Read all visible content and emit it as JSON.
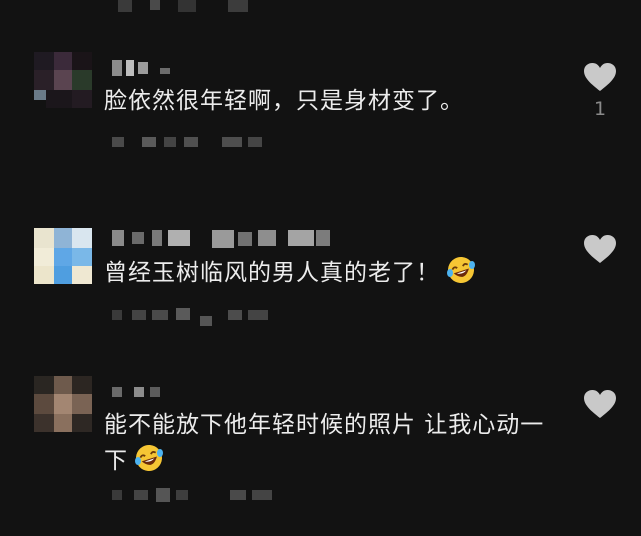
{
  "comments": [
    {
      "text": "脸依然很年轻啊，只是身材变了。",
      "like_count": "1",
      "has_emoji": false
    },
    {
      "text": "曾经玉树临风的男人真的老了！",
      "like_count": "",
      "has_emoji": true,
      "emoji": "laughing-crying-emoji"
    },
    {
      "text": "能不能放下他年轻时候的照片 让我心动一下",
      "like_count": "",
      "has_emoji": true,
      "emoji": "laughing-crying-emoji"
    }
  ],
  "icons": {
    "like": "heart-icon"
  },
  "colors": {
    "background": "#121212",
    "text": "#ececec",
    "muted": "#8a8a8a",
    "heart": "#c9c9c9",
    "emoji_face": "#f6c634"
  }
}
